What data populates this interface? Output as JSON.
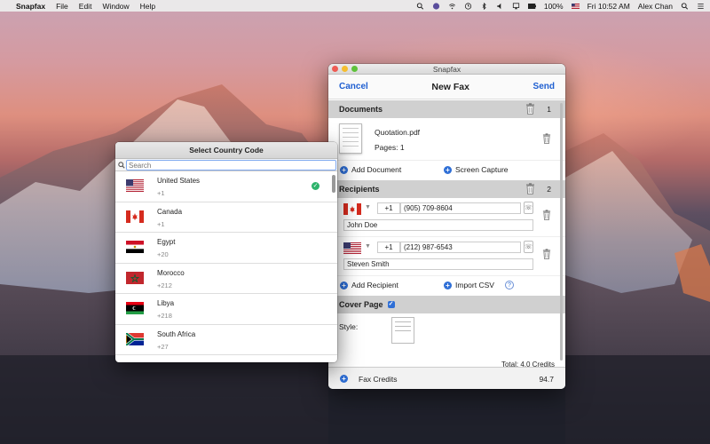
{
  "menubar": {
    "apple": "",
    "app_name": "Snapfax",
    "menus": [
      "File",
      "Edit",
      "Window",
      "Help"
    ],
    "battery": "100%",
    "clock": "Fri 10:52 AM",
    "user": "Alex Chan"
  },
  "fax_window": {
    "title": "Snapfax",
    "cancel_label": "Cancel",
    "heading": "New Fax",
    "send_label": "Send",
    "documents": {
      "header": "Documents",
      "count": "1",
      "items": [
        {
          "name": "Quotation.pdf",
          "pages": "Pages: 1"
        }
      ],
      "add_document": "Add Document",
      "screen_capture": "Screen Capture"
    },
    "recipients": {
      "header": "Recipients",
      "count": "2",
      "items": [
        {
          "flag": "canada-flag-icon",
          "code": "+1",
          "phone": "(905) 709-8604",
          "name": "John Doe"
        },
        {
          "flag": "us-flag-icon",
          "code": "+1",
          "phone": "(212) 987-6543",
          "name": "Steven Smith"
        }
      ],
      "add_recipient": "Add Recipient",
      "import_csv": "Import CSV",
      "help": "?"
    },
    "cover_page": {
      "header": "Cover Page",
      "checked": true,
      "style_label": "Style:"
    },
    "total": "Total: 4.0 Credits",
    "footer": {
      "label": "Fax Credits",
      "value": "94.7"
    }
  },
  "country_panel": {
    "title": "Select Country Code",
    "search_placeholder": "Search",
    "countries": [
      {
        "name": "United States",
        "code": "+1",
        "selected": true
      },
      {
        "name": "Canada",
        "code": "+1",
        "selected": false
      },
      {
        "name": "Egypt",
        "code": "+20",
        "selected": false
      },
      {
        "name": "Morocco",
        "code": "+212",
        "selected": false
      },
      {
        "name": "Libya",
        "code": "+218",
        "selected": false
      },
      {
        "name": "South Africa",
        "code": "+27",
        "selected": false
      }
    ]
  },
  "colors": {
    "accent": "#1f5fd1",
    "selected_check": "#2db36b",
    "section_header": "#d0d0d0"
  }
}
